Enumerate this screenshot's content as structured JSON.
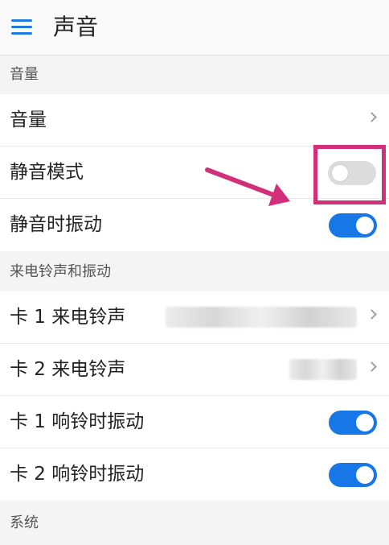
{
  "header": {
    "title": "声音",
    "menu_icon": "hamburger-menu-icon"
  },
  "sections": [
    {
      "title": "音量",
      "rows": [
        {
          "label": "音量",
          "control": "chevron"
        },
        {
          "label": "静音模式",
          "control": "toggle",
          "state": "off",
          "highlighted": true
        },
        {
          "label": "静音时振动",
          "control": "toggle",
          "state": "on"
        }
      ]
    },
    {
      "title": "来电铃声和振动",
      "rows": [
        {
          "label": "卡 1 来电铃声",
          "control": "chevron",
          "value_obscured": true
        },
        {
          "label": "卡 2 来电铃声",
          "control": "chevron",
          "value_obscured": true
        },
        {
          "label": "卡 1 响铃时振动",
          "control": "toggle",
          "state": "on"
        },
        {
          "label": "卡 2 响铃时振动",
          "control": "toggle",
          "state": "on"
        }
      ]
    },
    {
      "title": "系统",
      "rows": []
    }
  ],
  "colors": {
    "accent": "#1877e6",
    "annotation": "#d12f79",
    "toggle_off": "#dcdcdc",
    "background": "#f6f6f6"
  }
}
